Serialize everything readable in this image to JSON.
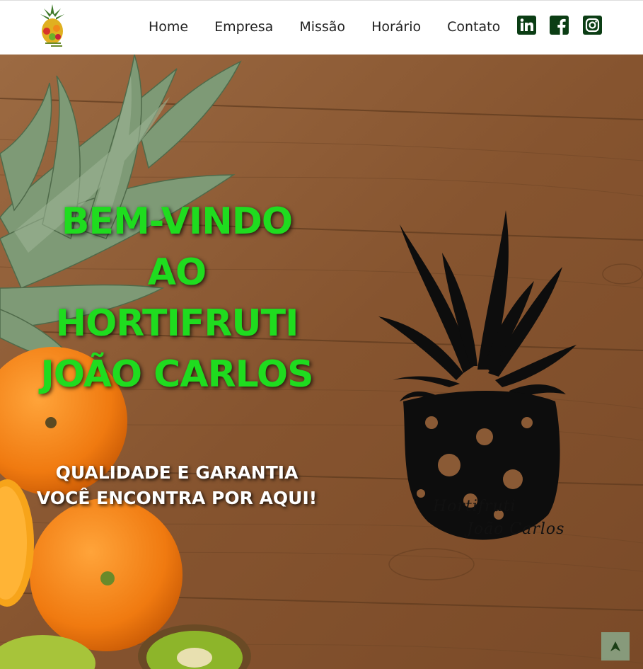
{
  "header": {
    "logo_icon": "pineapple-fruits-logo",
    "nav": [
      {
        "label": "Home"
      },
      {
        "label": "Empresa"
      },
      {
        "label": "Missão"
      },
      {
        "label": "Horário"
      },
      {
        "label": "Contato"
      }
    ],
    "social": [
      {
        "icon": "linkedin-icon"
      },
      {
        "icon": "facebook-icon"
      },
      {
        "icon": "instagram-icon"
      }
    ]
  },
  "hero": {
    "headline": "BEM-VINDO AO HORTIFRUTI JOÃO CARLOS",
    "tagline": "QUALIDADE E GARANTIA VOCÊ ENCONTRA POR AQUI!",
    "brand_line1": "Hortifruti",
    "brand_line2": "João Carlos",
    "headline_color": "#1fdc1f",
    "tagline_color": "#ffffff"
  },
  "back_to_top": {
    "icon": "arrow-up-icon"
  },
  "colors": {
    "nav_text": "#222222",
    "social": "#0b3d14",
    "wood": "#8a5a35"
  }
}
